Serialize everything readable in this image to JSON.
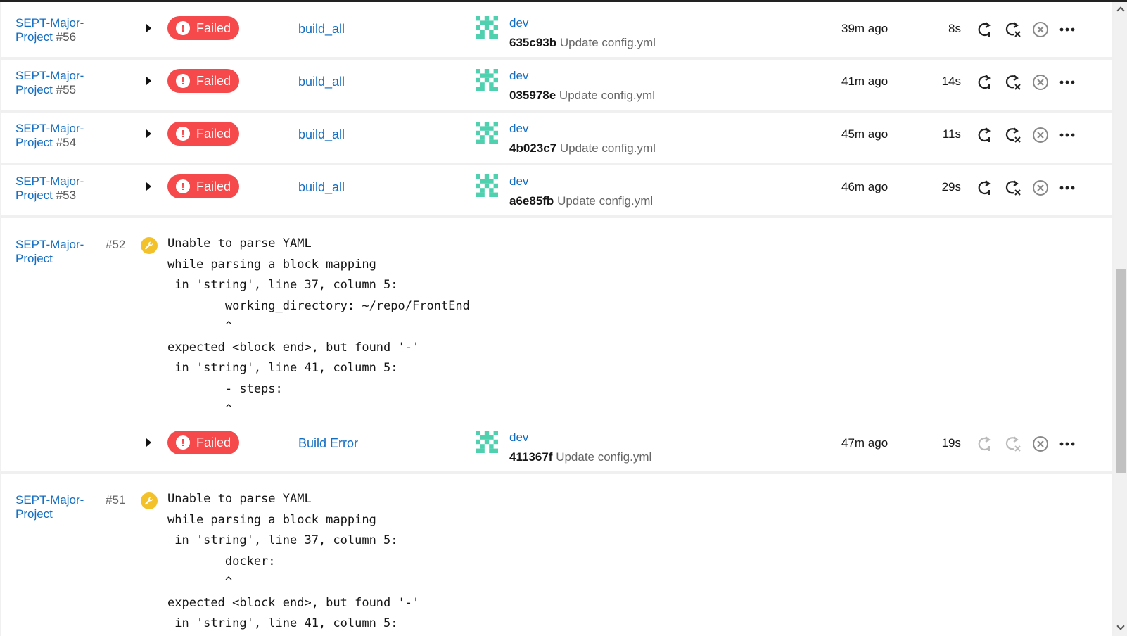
{
  "colors": {
    "link": "#136ec2",
    "failed": "#f5494c",
    "warning": "#f3c22b",
    "avatar": "#4fd1b0"
  },
  "rows": [
    {
      "project": "SEPT-Major-",
      "project2": "Project",
      "number": "#56",
      "status": "Failed",
      "workflow": "build_all",
      "branch": "dev",
      "sha": "635c93b",
      "message": "Update config.yml",
      "ago": "39m ago",
      "duration": "8s"
    },
    {
      "project": "SEPT-Major-",
      "project2": "Project",
      "number": "#55",
      "status": "Failed",
      "workflow": "build_all",
      "branch": "dev",
      "sha": "035978e",
      "message": "Update config.yml",
      "ago": "41m ago",
      "duration": "14s"
    },
    {
      "project": "SEPT-Major-",
      "project2": "Project",
      "number": "#54",
      "status": "Failed",
      "workflow": "build_all",
      "branch": "dev",
      "sha": "4b023c7",
      "message": "Update config.yml",
      "ago": "45m ago",
      "duration": "11s"
    },
    {
      "project": "SEPT-Major-",
      "project2": "Project",
      "number": "#53",
      "status": "Failed",
      "workflow": "build_all",
      "branch": "dev",
      "sha": "a6e85fb",
      "message": "Update config.yml",
      "ago": "46m ago",
      "duration": "29s"
    }
  ],
  "error_rows": [
    {
      "project": "SEPT-Major-",
      "project2": "Project",
      "number": "#52",
      "error": "Unable to parse YAML\nwhile parsing a block mapping\n in 'string', line 37, column 5:\n        working_directory: ~/repo/FrontEnd\n        ^\nexpected <block end>, but found '-'\n in 'string', line 41, column 5:\n        - steps:\n        ^",
      "status": "Failed",
      "workflow": "Build Error",
      "branch": "dev",
      "sha": "411367f",
      "message": "Update config.yml",
      "ago": "47m ago",
      "duration": "19s"
    },
    {
      "project": "SEPT-Major-",
      "project2": "Project",
      "number": "#51",
      "error": "Unable to parse YAML\nwhile parsing a block mapping\n in 'string', line 37, column 5:\n        docker:\n        ^\nexpected <block end>, but found '-'\n in 'string', line 41, column 5:"
    }
  ]
}
